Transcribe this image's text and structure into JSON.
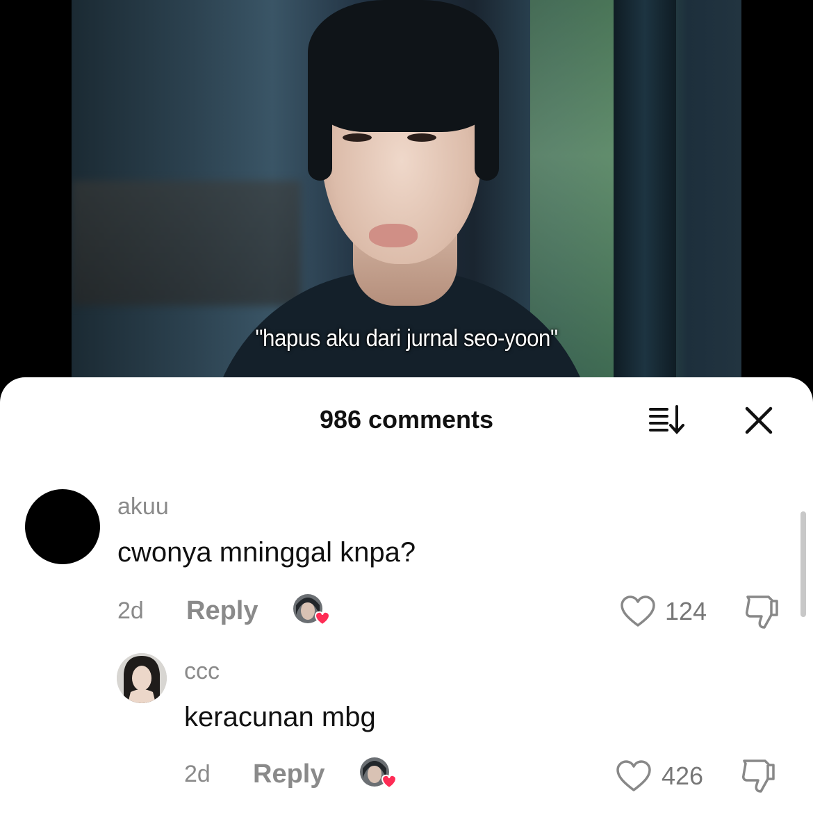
{
  "video": {
    "subtitle": "\"hapus aku dari jurnal seo-yoon\""
  },
  "comments_sheet": {
    "count_label": "986 comments",
    "sort_icon": "sort-icon",
    "close_icon": "close-icon"
  },
  "comments": [
    {
      "username": "akuu",
      "text": "cwonya mninggal knpa?",
      "time": "2d",
      "reply_label": "Reply",
      "likes": "124",
      "avatar_color": "#000000"
    },
    {
      "username": "ccc",
      "text": "keracunan mbg",
      "time": "2d",
      "reply_label": "Reply",
      "likes": "426"
    }
  ],
  "colors": {
    "heart_badge": "#fe2c55",
    "muted_text": "#8a8a8a"
  }
}
